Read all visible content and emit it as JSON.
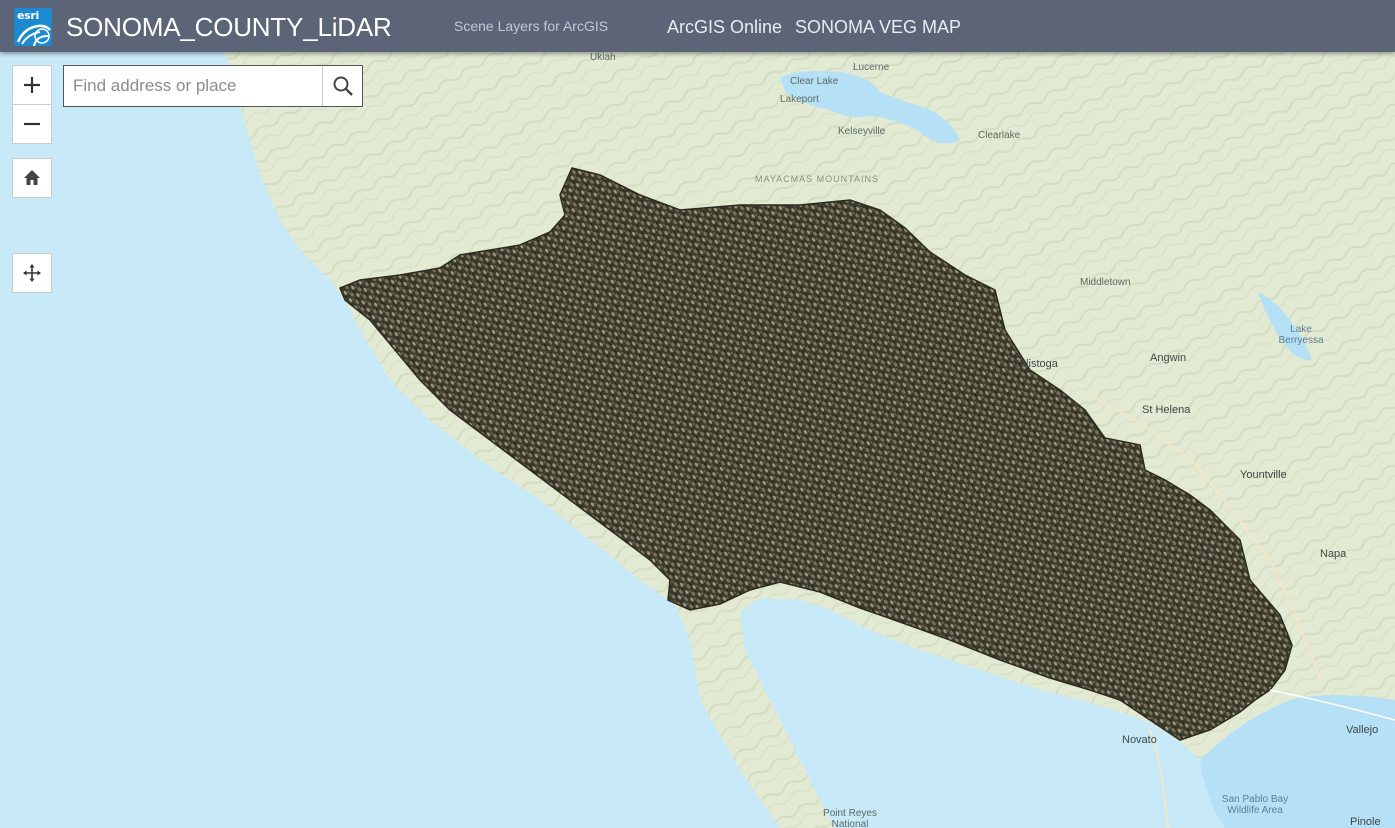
{
  "header": {
    "logo_text": "esri",
    "title": "SONOMA_COUNTY_LiDAR",
    "subtitle": "Scene Layers for ArcGIS",
    "nav": [
      "ArcGIS Online",
      "SONOMA VEG MAP"
    ]
  },
  "search": {
    "placeholder": "Find address or place"
  },
  "controls": {
    "zoom_in_icon": "plus-icon",
    "zoom_out_icon": "minus-icon",
    "home_icon": "home-icon",
    "pan_icon": "move-icon",
    "search_icon": "search-icon"
  },
  "map": {
    "labels": {
      "clear_lake": "Clear Lake",
      "lucerne": "Lucerne",
      "lakeport": "Lakeport",
      "kelseyville": "Kelseyville",
      "clearlake": "Clearlake",
      "mayacmas": "MAYACMAS MOUNTAINS",
      "calistoga": "Calistoga",
      "angwin": "Angwin",
      "st_helena": "St Helena",
      "lake_berryessa": "Lake Berryessa",
      "yountville": "Yountville",
      "napa": "Napa",
      "novato": "Novato",
      "vallejo": "Vallejo",
      "san_pablo": "San Pablo Bay Wildlife Area",
      "point_reyes": "Point Reyes National",
      "pinole": "Pinole",
      "ukiah": "Ukiah",
      "middletown": "Middletown"
    },
    "colors": {
      "water": "#c7e9f8",
      "land": "#e6ecd7",
      "lidar": "#3f3d2e"
    }
  }
}
